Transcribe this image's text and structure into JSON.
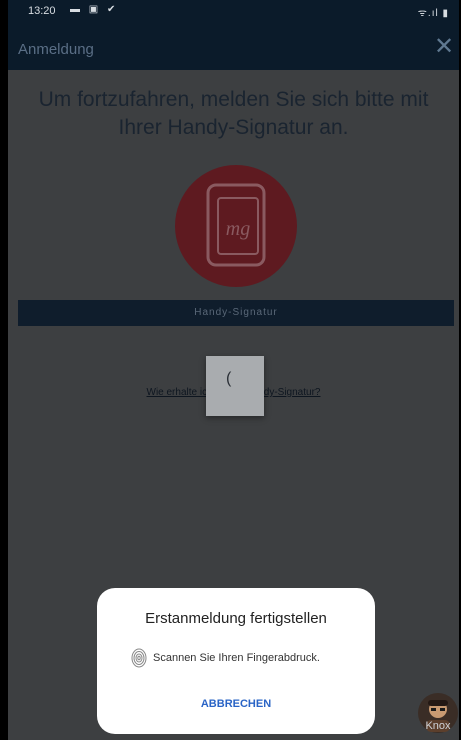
{
  "status_bar": {
    "time": "13:20",
    "left_icons": "▬ ▣ ✔",
    "right_icons": "ᯤ.ıl ▮"
  },
  "app_bar": {
    "title": "Anmeldung",
    "close_icon": "✕"
  },
  "main": {
    "headline": "Um fortzufahren, melden Sie sich bitte mit Ihrer Handy-Signatur an.",
    "logo_text": "mg",
    "button_label": "Handy-Signatur",
    "help_link": "Wie erhalte ich meine Handy-Signatur?",
    "spinner_glyph": "("
  },
  "dialog": {
    "title": "Erstanmeldung fertigstellen",
    "message": "Scannen Sie Ihren Fingerabdruck.",
    "cancel_label": "ABBRECHEN"
  },
  "knox": {
    "label": "Knox"
  },
  "colors": {
    "overlay_background": "#3d3f41",
    "app_bar": "#0b1b2a",
    "logo_circle": "#5e1a20",
    "dialog_background": "#ffffff",
    "cancel_text": "#2a64c6"
  },
  "icons": {
    "close": "close-icon",
    "fingerprint": "fingerprint-icon",
    "logo": "handy-signatur-logo-icon",
    "spinner": "loading-spinner-icon"
  }
}
